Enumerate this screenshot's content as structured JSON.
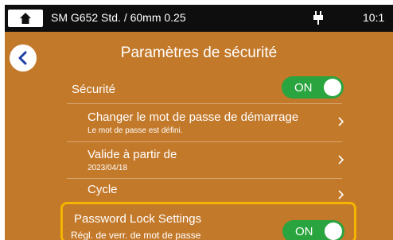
{
  "statusbar": {
    "title": "SM G652 Std. / 60mm 0.25",
    "time": "10:1"
  },
  "header": {
    "title": "Paramètres de sécurité"
  },
  "settings": {
    "security": {
      "label": "Sécurité",
      "toggle": "ON"
    },
    "change_password": {
      "label": "Changer le mot de passe de démarrage",
      "sub": "Le mot de passe est défini."
    },
    "valid_from": {
      "label": "Valide à partir de",
      "sub": "2023/04/18"
    },
    "cycle": {
      "label": "Cycle"
    },
    "password_lock": {
      "label": "Password Lock Settings",
      "sub": "Régl. de verr. de mot de passe",
      "toggle": "ON"
    }
  },
  "colors": {
    "background": "#c3792a",
    "statusbar": "#0e0e0e",
    "toggle_on": "#2aa43e",
    "highlight": "#f4b400"
  },
  "icons": [
    "home-icon",
    "power-plug-icon",
    "back-arrow-icon",
    "chevron-right-icon"
  ]
}
